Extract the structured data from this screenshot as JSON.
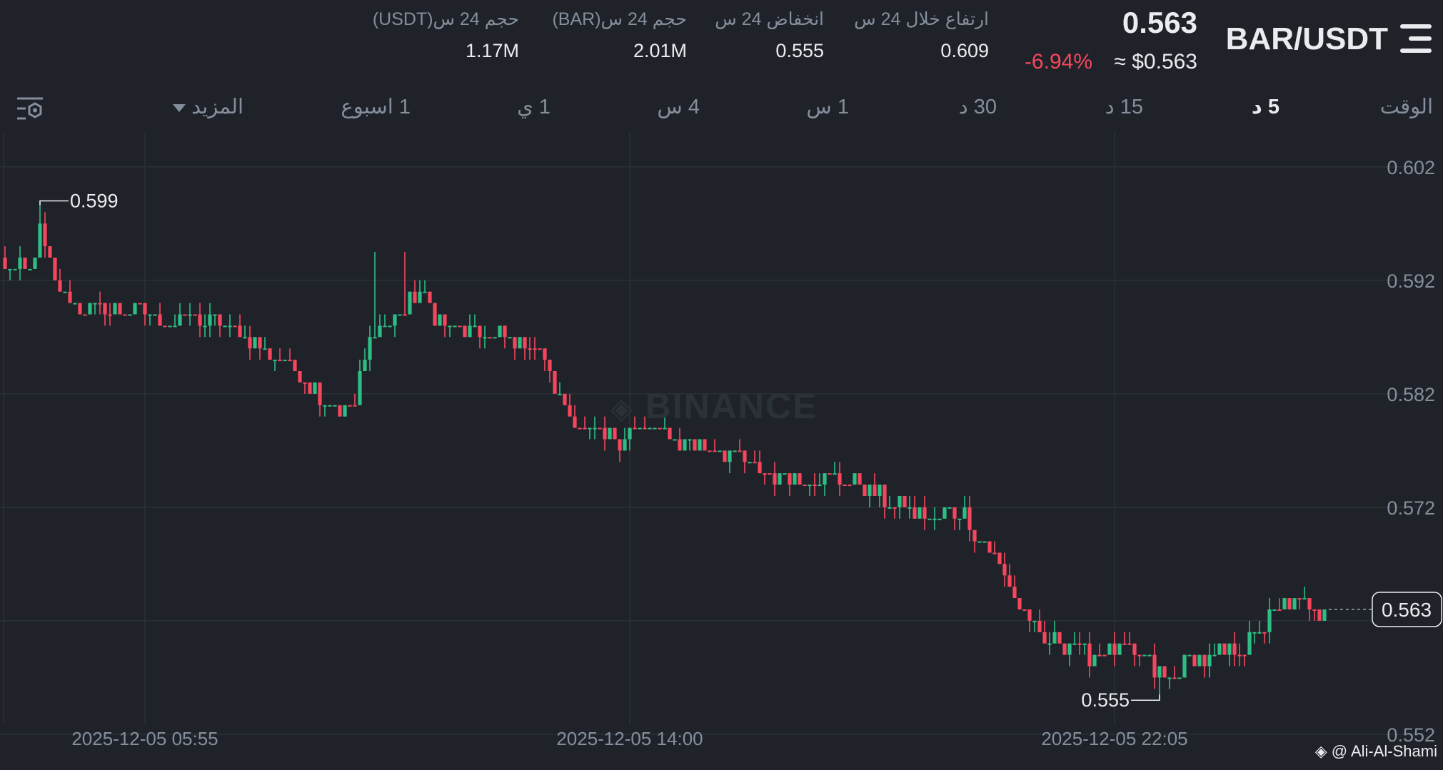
{
  "header": {
    "symbol": "BAR/USDT",
    "last_price": "0.563",
    "approx_price": "≈ $0.563",
    "change_pct": "-6.94%",
    "stats": [
      {
        "label": "ارتفاع خلال 24 س",
        "value": "0.609"
      },
      {
        "label": "انخفاض 24 س",
        "value": "0.555"
      },
      {
        "label": "حجم 24 س(BAR)",
        "value": "2.01M"
      },
      {
        "label": "حجم 24 س(USDT)",
        "value": "1.17M"
      }
    ]
  },
  "tabs": [
    {
      "label": "الوقت",
      "active": false
    },
    {
      "label": "5 د",
      "active": true
    },
    {
      "label": "15 د",
      "active": false
    },
    {
      "label": "30 د",
      "active": false
    },
    {
      "label": "1 س",
      "active": false
    },
    {
      "label": "4 س",
      "active": false
    },
    {
      "label": "1 ي",
      "active": false
    },
    {
      "label": "1 اسبوع",
      "active": false
    },
    {
      "label": "المزيد",
      "active": false
    }
  ],
  "watermark": "BINANCE",
  "credit": "@ Ali-Al-Shami",
  "colors": {
    "up": "#2ebd85",
    "down": "#f6465d",
    "grid": "#2b3139",
    "axis_text": "#848e9c",
    "background": "#1f2329"
  },
  "chart_data": {
    "type": "candlestick",
    "ylim": [
      0.5525,
      0.6045
    ],
    "y_ticks": [
      "0.602",
      "0.592",
      "0.582",
      "0.572",
      "0.552"
    ],
    "x_ticks": [
      "2025-12-05 05:55",
      "2025-12-05 14:00",
      "2025-12-05 22:05"
    ],
    "x_tick_candle_index": [
      28,
      125,
      222
    ],
    "candle_count": 265,
    "current_price": "0.563",
    "high_annotation": {
      "value": "0.599",
      "candle_index": 7
    },
    "low_annotation": {
      "value": "0.555",
      "candle_index": 231
    },
    "close_path": [
      [
        0,
        0.5932
      ],
      [
        5,
        0.5925
      ],
      [
        7,
        0.5965
      ],
      [
        10,
        0.592
      ],
      [
        14,
        0.5895
      ],
      [
        22,
        0.5895
      ],
      [
        30,
        0.5888
      ],
      [
        40,
        0.5885
      ],
      [
        46,
        0.5875
      ],
      [
        52,
        0.586
      ],
      [
        58,
        0.5845
      ],
      [
        63,
        0.582
      ],
      [
        67,
        0.5805
      ],
      [
        70,
        0.5812
      ],
      [
        73,
        0.587
      ],
      [
        76,
        0.588
      ],
      [
        80,
        0.5895
      ],
      [
        83,
        0.5905
      ],
      [
        88,
        0.588
      ],
      [
        95,
        0.587
      ],
      [
        102,
        0.587
      ],
      [
        107,
        0.586
      ],
      [
        110,
        0.5825
      ],
      [
        113,
        0.58
      ],
      [
        117,
        0.5785
      ],
      [
        121,
        0.578
      ],
      [
        128,
        0.579
      ],
      [
        134,
        0.578
      ],
      [
        143,
        0.5772
      ],
      [
        148,
        0.576
      ],
      [
        155,
        0.5748
      ],
      [
        162,
        0.5745
      ],
      [
        167,
        0.5742
      ],
      [
        172,
        0.5738
      ],
      [
        177,
        0.5725
      ],
      [
        182,
        0.5715
      ],
      [
        187,
        0.571
      ],
      [
        191,
        0.5718
      ],
      [
        193,
        0.5705
      ],
      [
        197,
        0.568
      ],
      [
        202,
        0.5645
      ],
      [
        207,
        0.56
      ],
      [
        212,
        0.56
      ],
      [
        218,
        0.559
      ],
      [
        224,
        0.5595
      ],
      [
        229,
        0.558
      ],
      [
        233,
        0.557
      ],
      [
        237,
        0.5582
      ],
      [
        243,
        0.5592
      ],
      [
        249,
        0.56
      ],
      [
        253,
        0.5622
      ],
      [
        256,
        0.5635
      ],
      [
        260,
        0.5638
      ],
      [
        262,
        0.5632
      ],
      [
        264,
        0.5628
      ]
    ]
  }
}
